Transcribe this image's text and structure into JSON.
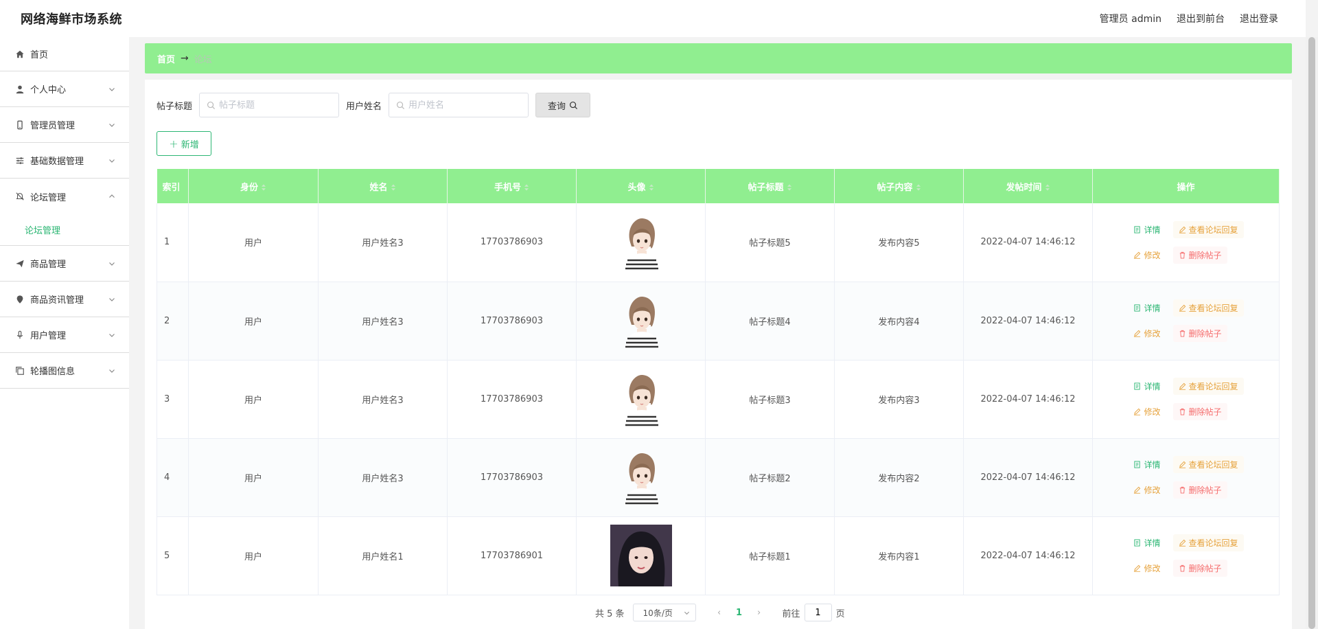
{
  "header": {
    "title": "网络海鲜市场系统",
    "user": "管理员 admin",
    "front_link": "退出到前台",
    "logout": "退出登录"
  },
  "sidebar": {
    "items": [
      {
        "label": "首页",
        "icon": "home-icon"
      },
      {
        "label": "个人中心",
        "icon": "user-icon"
      },
      {
        "label": "管理员管理",
        "icon": "phone-icon"
      },
      {
        "label": "基础数据管理",
        "icon": "sliders-icon"
      },
      {
        "label": "论坛管理",
        "icon": "bell-off-icon",
        "open": true,
        "sub": "论坛管理"
      },
      {
        "label": "商品管理",
        "icon": "send-icon"
      },
      {
        "label": "商品资讯管理",
        "icon": "location-icon"
      },
      {
        "label": "用户管理",
        "icon": "microphone-icon"
      },
      {
        "label": "轮播图信息",
        "icon": "copy-icon"
      }
    ]
  },
  "breadcrumb": {
    "home": "首页",
    "arrow": "→",
    "current": "论坛"
  },
  "search": {
    "title_label": "帖子标题",
    "title_placeholder": "帖子标题",
    "name_label": "用户姓名",
    "name_placeholder": "用户姓名",
    "query_label": "查询"
  },
  "add_label": "新增",
  "table": {
    "headers": [
      "索引",
      "身份",
      "姓名",
      "手机号",
      "头像",
      "帖子标题",
      "帖子内容",
      "发帖时间",
      "操作"
    ],
    "rows": [
      {
        "index": "1",
        "role": "用户",
        "name": "用户姓名3",
        "phone": "17703786903",
        "avatar": "cartoon-girl",
        "title": "帖子标题5",
        "content": "发布内容5",
        "time": "2022-04-07 14:46:12"
      },
      {
        "index": "2",
        "role": "用户",
        "name": "用户姓名3",
        "phone": "17703786903",
        "avatar": "cartoon-girl",
        "title": "帖子标题4",
        "content": "发布内容4",
        "time": "2022-04-07 14:46:12"
      },
      {
        "index": "3",
        "role": "用户",
        "name": "用户姓名3",
        "phone": "17703786903",
        "avatar": "cartoon-girl",
        "title": "帖子标题3",
        "content": "发布内容3",
        "time": "2022-04-07 14:46:12"
      },
      {
        "index": "4",
        "role": "用户",
        "name": "用户姓名3",
        "phone": "17703786903",
        "avatar": "cartoon-girl",
        "title": "帖子标题2",
        "content": "发布内容2",
        "time": "2022-04-07 14:46:12"
      },
      {
        "index": "5",
        "role": "用户",
        "name": "用户姓名1",
        "phone": "17703786901",
        "avatar": "photo-girl",
        "title": "帖子标题1",
        "content": "发布内容1",
        "time": "2022-04-07 14:46:12"
      }
    ],
    "ops": {
      "detail": "详情",
      "reply": "查看论坛回复",
      "edit": "修改",
      "delete": "删除帖子"
    }
  },
  "pagination": {
    "total": "共 5 条",
    "page_size": "10条/页",
    "current": "1",
    "goto": "前往",
    "goto_value": "1",
    "page_suffix": "页"
  },
  "colors": {
    "accent": "#90ee90",
    "primary": "#2bb673",
    "warning": "#e6a23c",
    "danger": "#f56c6c"
  }
}
